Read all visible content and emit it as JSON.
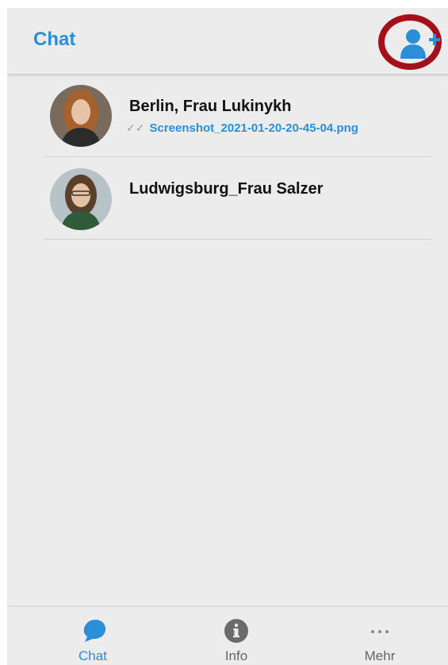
{
  "header": {
    "title": "Chat",
    "add_contact_icon": "add-user-icon"
  },
  "chats": [
    {
      "name": "Berlin, Frau Lukinykh",
      "last_message": "Screenshot_2021-01-20-20-45-04.png",
      "status_icon": "double-check-icon"
    },
    {
      "name": "Ludwigsburg_Frau Salzer",
      "last_message": ""
    }
  ],
  "nav": {
    "items": [
      {
        "label": "Chat",
        "icon": "chat-bubble-icon",
        "active": true
      },
      {
        "label": "Info",
        "icon": "info-icon",
        "active": false
      },
      {
        "label": "Mehr",
        "icon": "more-icon",
        "active": false
      }
    ]
  },
  "colors": {
    "accent": "#2a8fd6",
    "highlight_ring": "#a40f1c",
    "background": "#ececec"
  }
}
